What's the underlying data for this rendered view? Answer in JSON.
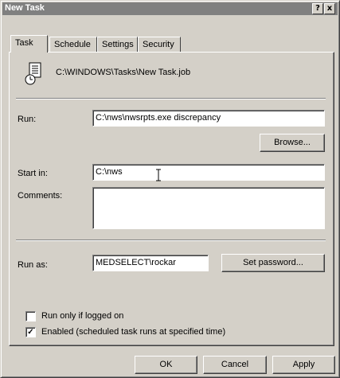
{
  "window": {
    "title": "New Task",
    "help_label": "?",
    "close_label": "x"
  },
  "tabs": [
    {
      "label": "Task",
      "active": true
    },
    {
      "label": "Schedule",
      "active": false
    },
    {
      "label": "Settings",
      "active": false
    },
    {
      "label": "Security",
      "active": false
    }
  ],
  "task": {
    "file_path": "C:\\WINDOWS\\Tasks\\New Task.job",
    "run_label": "Run:",
    "run_value": "C:\\nws\\nwsrpts.exe discrepancy",
    "browse_label": "Browse...",
    "start_in_label": "Start in:",
    "start_in_value": "C:\\nws",
    "comments_label": "Comments:",
    "comments_value": "",
    "run_as_label": "Run as:",
    "run_as_value": "MEDSELECT\\rockar",
    "set_password_label": "Set password...",
    "run_only_logged_on_label": "Run only if logged on",
    "run_only_logged_on_checked": false,
    "enabled_label": "Enabled (scheduled task runs at specified time)",
    "enabled_checked": true
  },
  "footer": {
    "ok_label": "OK",
    "cancel_label": "Cancel",
    "apply_label": "Apply"
  },
  "icons": {
    "task": "scheduled-task-icon",
    "cursor": "text-cursor-icon"
  }
}
